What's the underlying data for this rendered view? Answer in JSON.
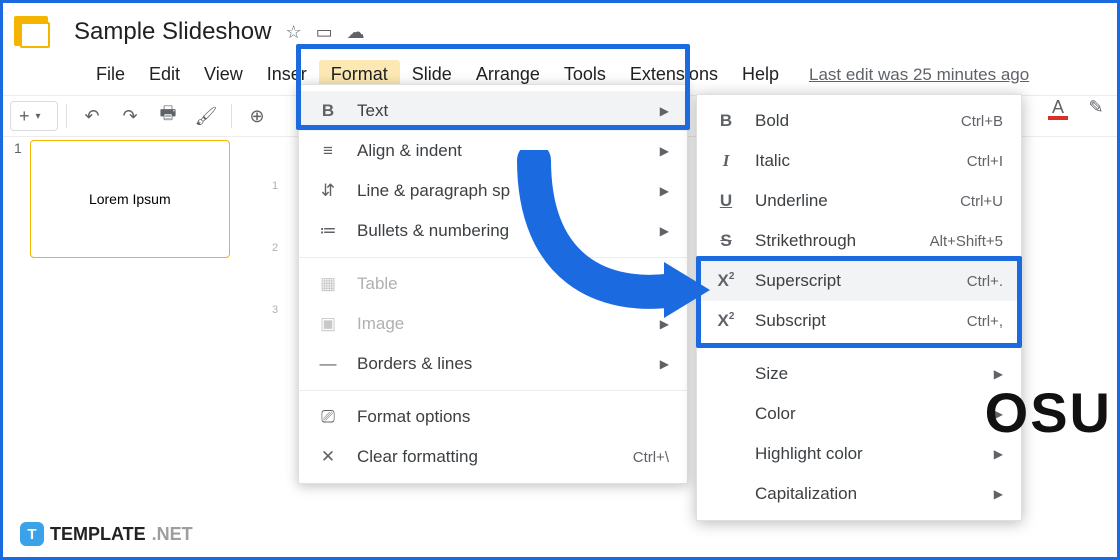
{
  "app": {
    "doc_title": "Sample Slideshow",
    "title_icons": {
      "star": "☆",
      "move": "▭",
      "cloud": "☁"
    }
  },
  "menubar": {
    "items": [
      {
        "label": "File"
      },
      {
        "label": "Edit"
      },
      {
        "label": "View"
      },
      {
        "label": "Insert_trunc",
        "display": "Inser"
      },
      {
        "label": "Format",
        "active": true
      },
      {
        "label": "Slide"
      },
      {
        "label": "Arrange"
      },
      {
        "label": "Tools"
      },
      {
        "label": "Extensions"
      },
      {
        "label": "Help_trunc",
        "display": "Help"
      }
    ],
    "last_edit": "Last edit was 25 minutes ago"
  },
  "toolbar": {
    "plus": "+",
    "undo": "↶",
    "redo": "↷",
    "print": "🖶",
    "paint": "🖌",
    "zoom": "⊕",
    "text_color": "A",
    "pen": "✎"
  },
  "sidebar": {
    "slides": [
      {
        "n": "1",
        "content": "Lorem Ipsum"
      }
    ]
  },
  "format_menu": {
    "items": [
      {
        "icon": "B",
        "label": "Text",
        "arrow": true,
        "hover": true,
        "bold": true
      },
      {
        "icon": "≡",
        "label": "Align & indent",
        "arrow": true
      },
      {
        "icon": "⇵",
        "label": "Line & paragraph spacing",
        "arrow": true,
        "trunc": "Line & paragraph sp"
      },
      {
        "icon": "≔",
        "label": "Bullets & numbering",
        "arrow": true
      },
      {
        "sep": true
      },
      {
        "icon": "▦",
        "label": "Table",
        "arrow": true,
        "disabled": true
      },
      {
        "icon": "▣",
        "label": "Image",
        "arrow": true,
        "disabled": true
      },
      {
        "icon": "—",
        "label": "Borders & lines",
        "arrow": true
      },
      {
        "sep": true
      },
      {
        "icon": "⎚",
        "label": "Format options"
      },
      {
        "icon": "✕",
        "label": "Clear formatting",
        "shortcut": "Ctrl+\\"
      }
    ]
  },
  "text_submenu": {
    "items": [
      {
        "icon": "B",
        "icon_cls": "bold",
        "label": "Bold",
        "shortcut": "Ctrl+B"
      },
      {
        "icon": "I",
        "icon_cls": "italic",
        "label": "Italic",
        "shortcut": "Ctrl+I"
      },
      {
        "icon": "U",
        "icon_cls": "ul",
        "label": "Underline",
        "shortcut": "Ctrl+U"
      },
      {
        "icon": "S",
        "icon_cls": "strike",
        "label": "Strikethrough",
        "shortcut": "Alt+Shift+5"
      },
      {
        "icon": "X²",
        "icon_cls": "",
        "label": "Superscript",
        "shortcut": "Ctrl+.",
        "hover": true
      },
      {
        "icon": "X₂",
        "icon_cls": "",
        "label": "Subscript",
        "shortcut": "Ctrl+,"
      },
      {
        "sep": true
      },
      {
        "label": "Size",
        "arrow": true
      },
      {
        "label": "Color",
        "arrow": true
      },
      {
        "label": "Highlight color",
        "arrow": true
      },
      {
        "label": "Capitalization",
        "arrow": true
      }
    ]
  },
  "watermark": {
    "brand": "TEMPLATE",
    "suffix": ".NET",
    "badge": "T"
  },
  "slide_peek": "OSU"
}
